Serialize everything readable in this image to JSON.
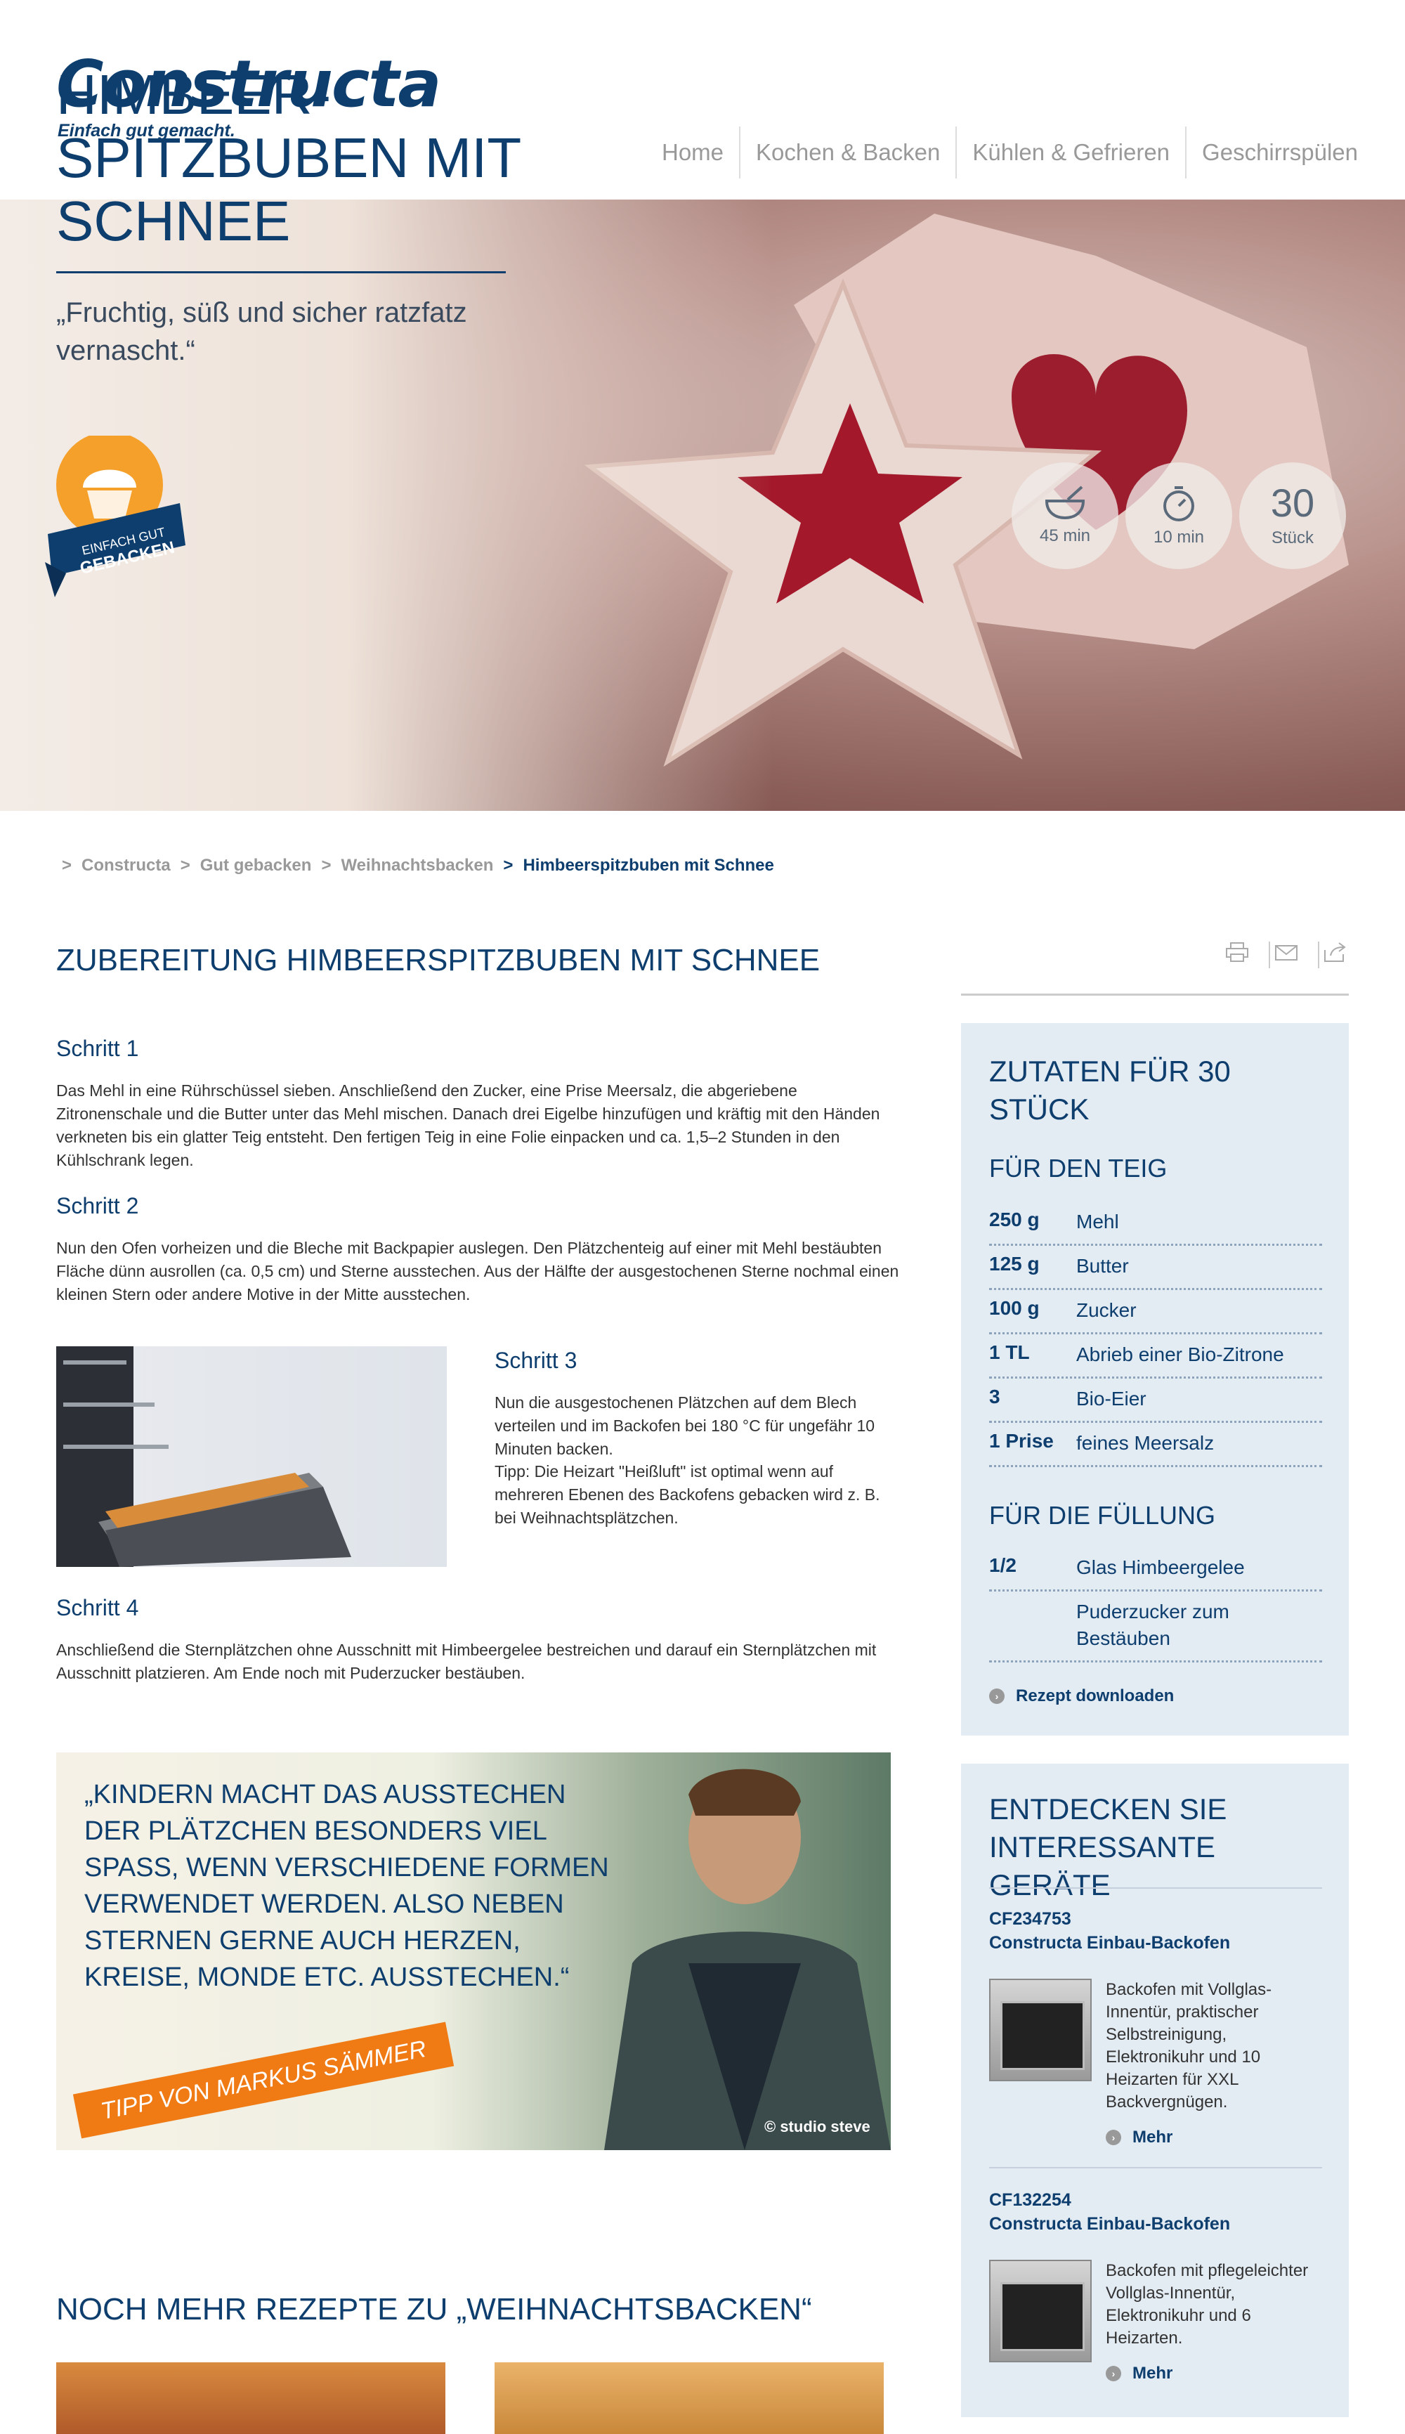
{
  "header": {
    "logo": "Constructa",
    "tagline": "Einfach gut gemacht.",
    "nav": [
      "Home",
      "Kochen & Backen",
      "Kühlen & Gefrieren",
      "Geschirrspülen"
    ]
  },
  "hero": {
    "title": "HIMBEER-SPITZBUBEN MIT SCHNEE",
    "quote": "„Fruchtig, süß und sicher ratzfatz vernascht.“",
    "badge_text_1": "EINFACH GUT",
    "badge_text_2": "GEBACKEN",
    "stats": [
      {
        "icon": "bowl-icon",
        "value": "",
        "label": "45 min"
      },
      {
        "icon": "stopwatch-icon",
        "value": "",
        "label": "10 min"
      },
      {
        "icon": "count",
        "value": "30",
        "label": "Stück"
      }
    ]
  },
  "breadcrumb": [
    "Constructa",
    "Gut gebacken",
    "Weihnachtsbacken",
    "Himbeerspitzbuben mit Schnee"
  ],
  "main": {
    "heading": "ZUBEREITUNG HIMBEERSPITZBUBEN MIT SCHNEE",
    "steps": [
      {
        "title": "Schritt 1",
        "text": "Das Mehl in eine Rührschüssel sieben. Anschließend den Zucker, eine Prise Meersalz, die abgeriebene Zitronenschale und die Butter unter das Mehl mischen. Danach drei Eigelbe hinzufügen und kräftig mit den Händen verkneten bis ein glatter Teig entsteht. Den fertigen Teig in eine Folie einpacken und ca. 1,5–2 Stunden in den Kühlschrank legen."
      },
      {
        "title": "Schritt 2",
        "text": "Nun den Ofen vorheizen und die Bleche mit Backpapier auslegen. Den Plätzchenteig auf einer mit Mehl bestäubten Fläche dünn ausrollen (ca. 0,5 cm) und Sterne ausstechen. Aus der Hälfte der ausgestochenen Sterne nochmal einen kleinen Stern oder andere Motive in der Mitte ausstechen."
      },
      {
        "title": "Schritt 3",
        "text": "Nun die ausgestochenen Plätzchen auf dem Blech verteilen und im Backofen bei 180 °C für ungefähr 10 Minuten backen.",
        "tip": "Tipp: Die Heizart \"Heißluft\" ist optimal wenn auf mehreren Ebenen des Backofens gebacken wird z. B. bei Weihnachtsplätzchen."
      },
      {
        "title": "Schritt 4",
        "text": "Anschließend die Sternplätzchen ohne Ausschnitt mit Himbeergelee bestreichen und darauf ein Sternplätzchen mit Ausschnitt platzieren. Am Ende noch mit Puderzucker bestäuben."
      }
    ],
    "tip_quote": "„KINDERN MACHT DAS AUSSTECHEN DER PLÄTZCHEN BESONDERS VIEL SPASS, WENN VERSCHIEDENE FORMEN VERWENDET WERDEN. ALSO NEBEN STERNEN GERNE AUCH HERZEN, KREISE, MONDE ETC. AUSSTECHEN.“",
    "tip_ribbon": "TIPP VON MARKUS SÄMMER",
    "tip_copyright": "© studio steve",
    "more_heading": "NOCH MEHR REZEPTE ZU „WEIHNACHTSBACKEN“"
  },
  "ingredients": {
    "title": "ZUTATEN FÜR 30 STÜCK",
    "dough_title": "FÜR DEN TEIG",
    "dough": [
      {
        "q": "250 g",
        "n": "Mehl"
      },
      {
        "q": "125 g",
        "n": "Butter"
      },
      {
        "q": "100 g",
        "n": "Zucker"
      },
      {
        "q": "1 TL",
        "n": "Abrieb einer Bio-Zitrone"
      },
      {
        "q": "3",
        "n": "Bio-Eier"
      },
      {
        "q": "1 Prise",
        "n": "feines Meersalz"
      }
    ],
    "filling_title": "FÜR DIE FÜLLUNG",
    "filling": [
      {
        "q": "1/2",
        "n": "Glas Himbeergelee"
      },
      {
        "q": "",
        "n": "Puderzucker zum Bestäuben"
      }
    ],
    "download": "Rezept downloaden"
  },
  "devices": {
    "title": "ENTDECKEN SIE INTERESSANTE GERÄTE",
    "items": [
      {
        "id": "CF234753",
        "name": "Constructa Einbau-Backofen",
        "desc": "Backofen mit Vollglas-Innentür, praktischer Selbstreinigung, Elektronikuhr und 10 Heizarten für XXL Backvergnügen.",
        "more": "Mehr"
      },
      {
        "id": "CF132254",
        "name": "Constructa Einbau-Backofen",
        "desc": "Backofen mit pflegeleichter Vollglas-Innentür, Elektronikuhr und 6 Heizarten.",
        "more": "Mehr"
      }
    ]
  }
}
